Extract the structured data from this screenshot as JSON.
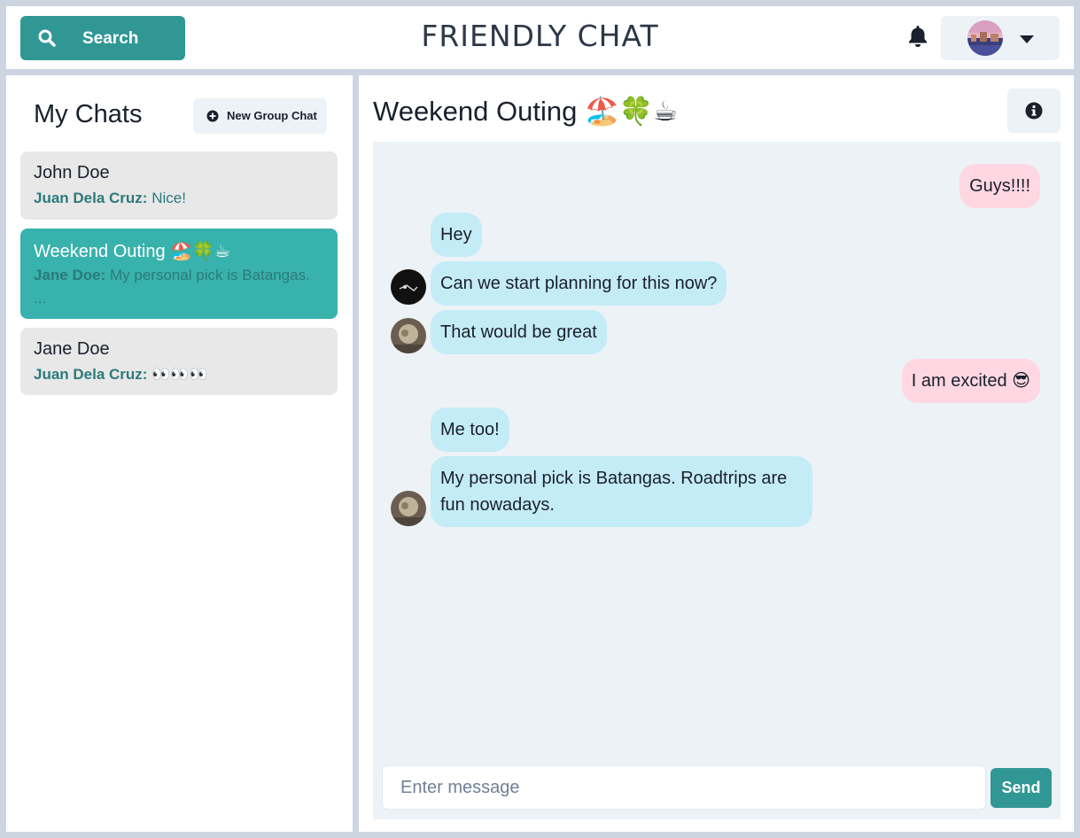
{
  "header": {
    "search_label": "Search",
    "app_title": "FRIENDLY CHAT"
  },
  "sidebar": {
    "title": "My Chats",
    "new_group_label": "New Group Chat",
    "chats": [
      {
        "name": "John Doe",
        "sender": "Juan Dela Cruz:",
        "preview": "Nice!",
        "active": false
      },
      {
        "name": "Weekend Outing 🏖️🍀☕",
        "sender": "Jane Doe:",
        "preview": "My personal pick is Batangas. ...",
        "active": true
      },
      {
        "name": "Jane Doe",
        "sender": "Juan Dela Cruz:",
        "preview": "👀👀👀",
        "active": false
      }
    ]
  },
  "chat": {
    "title": "Weekend Outing 🏖️🍀☕",
    "messages": [
      {
        "text": "Guys!!!!",
        "mine": true
      },
      {
        "text": "Hey",
        "mine": false
      },
      {
        "text": "Can we start planning for this now?",
        "mine": false
      },
      {
        "text": "That would be great",
        "mine": false
      },
      {
        "text": "I am excited 😎",
        "mine": true
      },
      {
        "text": "Me too!",
        "mine": false
      },
      {
        "text": "My personal pick is Batangas. Roadtrips are fun nowadays.",
        "mine": false
      }
    ],
    "input_placeholder": "Enter message",
    "send_label": "Send"
  },
  "colors": {
    "teal": "#319795",
    "active_chat": "#38b2ac",
    "my_bubble": "#fed7e2",
    "their_bubble": "#c4ecf6",
    "background": "#cdd6e0"
  },
  "icons": [
    "search-icon",
    "bell-icon",
    "chevron-down-icon",
    "plus-circle-icon",
    "info-icon"
  ]
}
